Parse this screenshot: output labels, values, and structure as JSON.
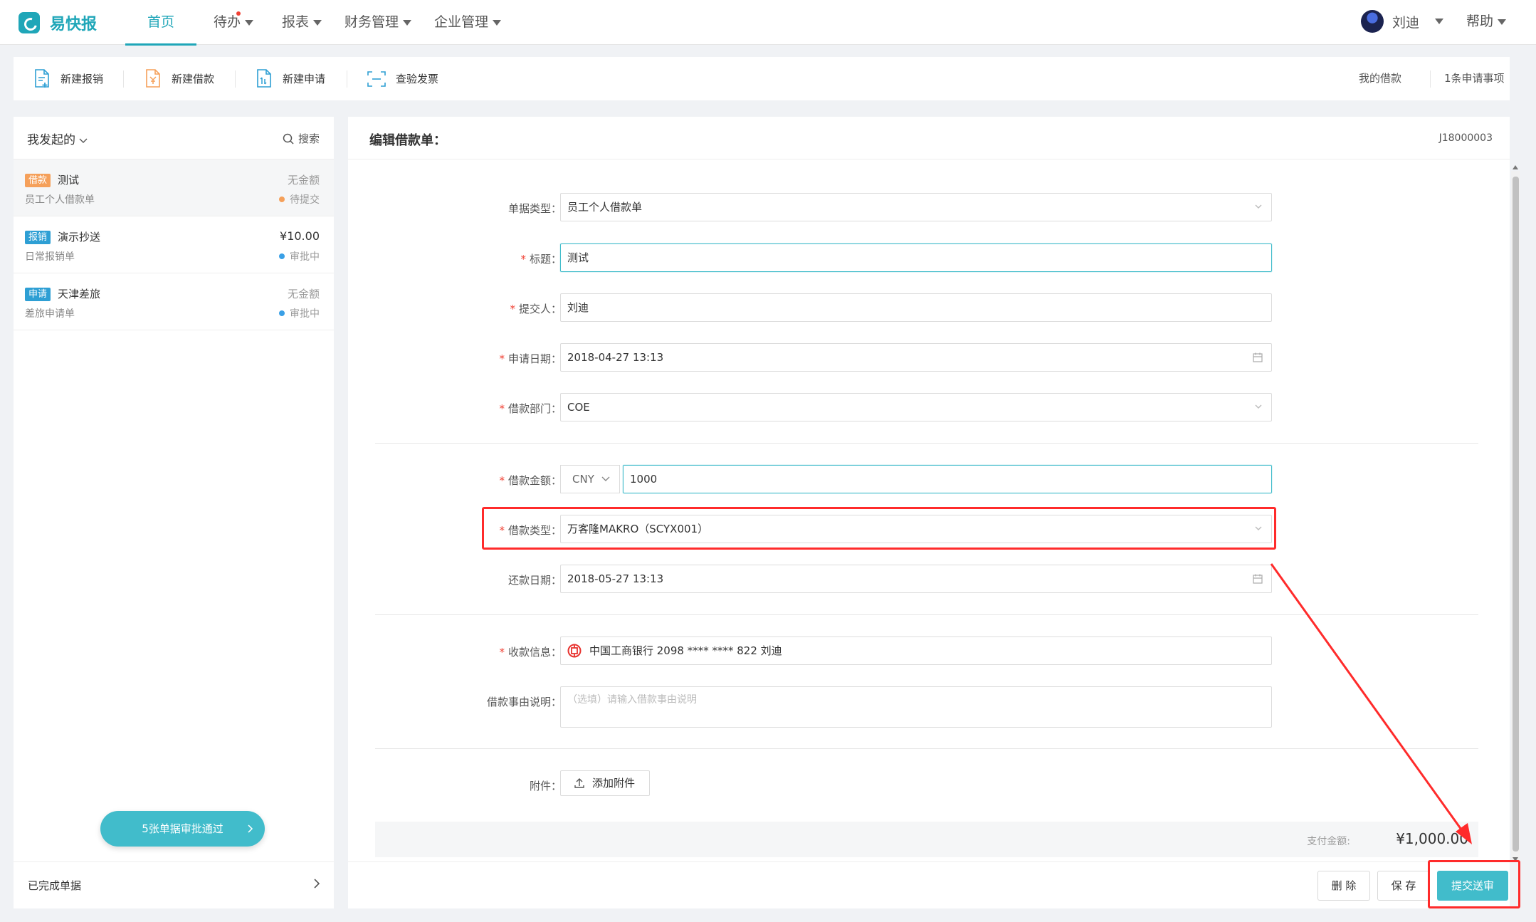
{
  "app": {
    "logo_text": "易快报"
  },
  "nav": {
    "items": [
      {
        "label": "首页",
        "active": true
      },
      {
        "label": "待办",
        "dropdown": true,
        "badge_dot": true
      },
      {
        "label": "报表",
        "dropdown": true
      },
      {
        "label": "财务管理",
        "dropdown": true
      },
      {
        "label": "企业管理",
        "dropdown": true
      }
    ],
    "user_name": "刘迪",
    "help_label": "帮助"
  },
  "actions": {
    "new_expense": "新建报销",
    "new_loan": "新建借款",
    "new_request": "新建申请",
    "verify_invoice": "查验发票",
    "my_loans": "我的借款",
    "pending_requests": "1条申请事项"
  },
  "left": {
    "title": "我发起的",
    "search_label": "搜索",
    "items": [
      {
        "tag": "借款",
        "tag_color": "#f5a05a",
        "title": "测试",
        "subtitle": "员工个人借款单",
        "amount": "无金额",
        "status": "待提交",
        "status_color": "#f5a05a"
      },
      {
        "tag": "报销",
        "tag_color": "#2e9fd4",
        "title": "演示抄送",
        "subtitle": "日常报销单",
        "amount": "¥10.00",
        "status": "审批中",
        "status_color": "#3aa0e6"
      },
      {
        "tag": "申请",
        "tag_color": "#2e9fd4",
        "title": "天津差旅",
        "subtitle": "差旅申请单",
        "amount": "无金额",
        "status": "审批中",
        "status_color": "#3aa0e6"
      }
    ],
    "approved_pill": "5张单据审批通过",
    "completed_label": "已完成单据"
  },
  "form": {
    "title": "编辑借款单：",
    "doc_no": "J18000003",
    "fields": {
      "doc_type": {
        "label": "单据类型：",
        "value": "员工个人借款单"
      },
      "title": {
        "label": "标题：",
        "value": "测试"
      },
      "submitter": {
        "label": "提交人：",
        "value": "刘迪"
      },
      "apply_date": {
        "label": "申请日期：",
        "value": "2018-04-27 13:13"
      },
      "department": {
        "label": "借款部门：",
        "value": "COE"
      },
      "amount": {
        "label": "借款金额：",
        "currency": "CNY",
        "value": "1000"
      },
      "loan_type": {
        "label": "借款类型：",
        "value": "万客隆MAKRO（SCYX001）"
      },
      "repay_date": {
        "label": "还款日期：",
        "value": "2018-05-27 13:13"
      },
      "payee": {
        "label": "收款信息：",
        "value": "中国工商银行 2098 **** **** 822 刘迪"
      },
      "reason": {
        "label": "借款事由说明：",
        "placeholder": "（选填）请输入借款事由说明"
      },
      "attachment": {
        "label": "附件：",
        "button": "添加附件"
      }
    },
    "pay_label": "支付金额:",
    "pay_value": "¥1,000.00",
    "buttons": {
      "delete": "删 除",
      "save": "保 存",
      "submit": "提交送审"
    }
  },
  "colors": {
    "accent": "#41bccb",
    "required": "#f04134",
    "annotation": "#ff2b2b"
  },
  "icons": [
    "logo-icon",
    "document-plus-icon",
    "loan-doc-icon",
    "request-doc-icon",
    "scan-icon",
    "search-icon",
    "chevron-down-icon",
    "calendar-icon",
    "icbc-bank-icon",
    "upload-icon",
    "chevron-right-icon"
  ]
}
